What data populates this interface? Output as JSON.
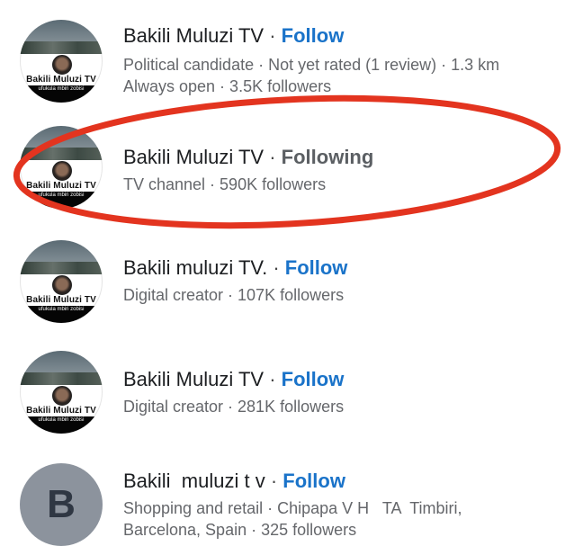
{
  "results": [
    {
      "avatar": {
        "type": "logo",
        "brand": "Bakili Muluzi TV",
        "tagline": "ufukula mbiri zobisi"
      },
      "name": "Bakili Muluzi TV",
      "separator": "·",
      "action": "Follow",
      "action_state": "follow",
      "meta_lines": [
        "Political candidate · Not yet rated (1 review) · 1.3 km",
        "Always open · 3.5K followers"
      ]
    },
    {
      "avatar": {
        "type": "logo",
        "brand": "Bakili Muluzi TV",
        "tagline": "ufukula mbiri zobisi"
      },
      "name": "Bakili Muluzi TV",
      "separator": "·",
      "action": "Following",
      "action_state": "following",
      "meta_lines": [
        "TV channel · 590K followers"
      ]
    },
    {
      "avatar": {
        "type": "logo",
        "brand": "Bakili Muluzi TV",
        "tagline": "ufukula mbiri zobisi"
      },
      "name": "Bakili muluzi TV.",
      "separator": "·",
      "action": "Follow",
      "action_state": "follow",
      "meta_lines": [
        "Digital creator · 107K followers"
      ]
    },
    {
      "avatar": {
        "type": "logo",
        "brand": "Bakili Muluzi TV",
        "tagline": "ufukula mbiri zobisi"
      },
      "name": "Bakili Muluzi TV",
      "separator": "·",
      "action": "Follow",
      "action_state": "follow",
      "meta_lines": [
        "Digital creator · 281K followers"
      ]
    },
    {
      "avatar": {
        "type": "letter",
        "letter": "B"
      },
      "name": "Bakili  muluzi t v",
      "separator": "·",
      "action": "Follow",
      "action_state": "follow",
      "meta_lines": [
        "Shopping and retail · Chipapa V H   TA  Timbiri,",
        "Barcelona, Spain · 325 followers"
      ]
    }
  ],
  "colors": {
    "follow": "#1a73c9",
    "following": "#5b5f63",
    "highlight": "#e3341f"
  }
}
